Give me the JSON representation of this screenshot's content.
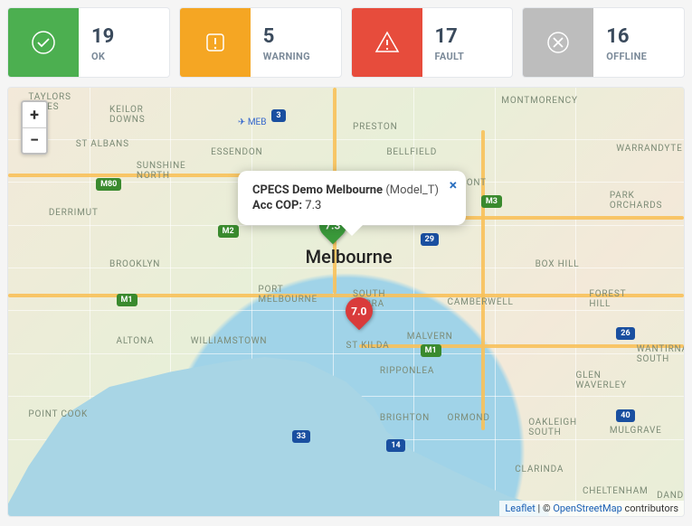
{
  "stats": {
    "ok": {
      "value": "19",
      "label": "OK"
    },
    "warning": {
      "value": "5",
      "label": "WARNING"
    },
    "fault": {
      "value": "17",
      "label": "FAULT"
    },
    "offline": {
      "value": "16",
      "label": "OFFLINE"
    }
  },
  "map": {
    "zoom_in": "+",
    "zoom_out": "−",
    "city_main": "Melbourne",
    "airport_label": "✈ MEB",
    "popup": {
      "title": "CPECS Demo Melbourne",
      "subtitle": "(Model_T)",
      "metric_label": "Acc COP:",
      "metric_value": "7.3"
    },
    "markers": {
      "green": "7.3",
      "red": "7.0"
    },
    "shields": {
      "m80": "M80",
      "m2": "M2",
      "m1a": "M1",
      "m1b": "M1",
      "m3": "M3",
      "r29": "29",
      "r14": "14",
      "r33": "33",
      "r40": "40",
      "r26": "26",
      "r3": "3"
    },
    "suburbs": {
      "taylors_lakes": "TAYLORS\nLAKES",
      "keilor_downs": "KEILOR\nDOWNS",
      "st_albans": "ST ALBANS",
      "sunshine_north": "SUNSHINE\nNORTH",
      "derrimut": "DERRIMUT",
      "brooklyn": "BROOKLYN",
      "altona": "ALTONA",
      "williamstown": "WILLIAMSTOWN",
      "point_cook": "POINT COOK",
      "essendon": "ESSENDON",
      "port_melbourne": "PORT\nMELBOURNE",
      "south_yarra": "SOUTH\nYARRA",
      "st_kilda": "ST KILDA",
      "ripponlea": "RIPPONLEA",
      "brighton": "BRIGHTON",
      "preston": "PRESTON",
      "bellfield": "BELLFIELD",
      "eaglemont": "EAGLEMONT",
      "montmorency": "MONTMORENCY",
      "warrandyte": "WARRANDYTE",
      "park_orchards": "PARK\nORCHARDS",
      "box_hill": "BOX HILL",
      "forest_hill": "FOREST\nHILL",
      "wantirna_south": "WANTIRNA\nSOUTH",
      "glen_waverley": "GLEN\nWAVERLEY",
      "camberwell": "CAMBERWELL",
      "malvern": "MALVERN",
      "ormond": "ORMOND",
      "oakleigh_south": "OAKLEIGH\nSOUTH",
      "clarinda": "CLARINDA",
      "mulgrave": "MULGRAVE",
      "cheltenham": "CHELTENHAM",
      "dandi": "DANDI"
    },
    "attribution": {
      "leaflet": "Leaflet",
      "sep": " | © ",
      "osm": "OpenStreetMap",
      "suffix": " contributors"
    }
  }
}
